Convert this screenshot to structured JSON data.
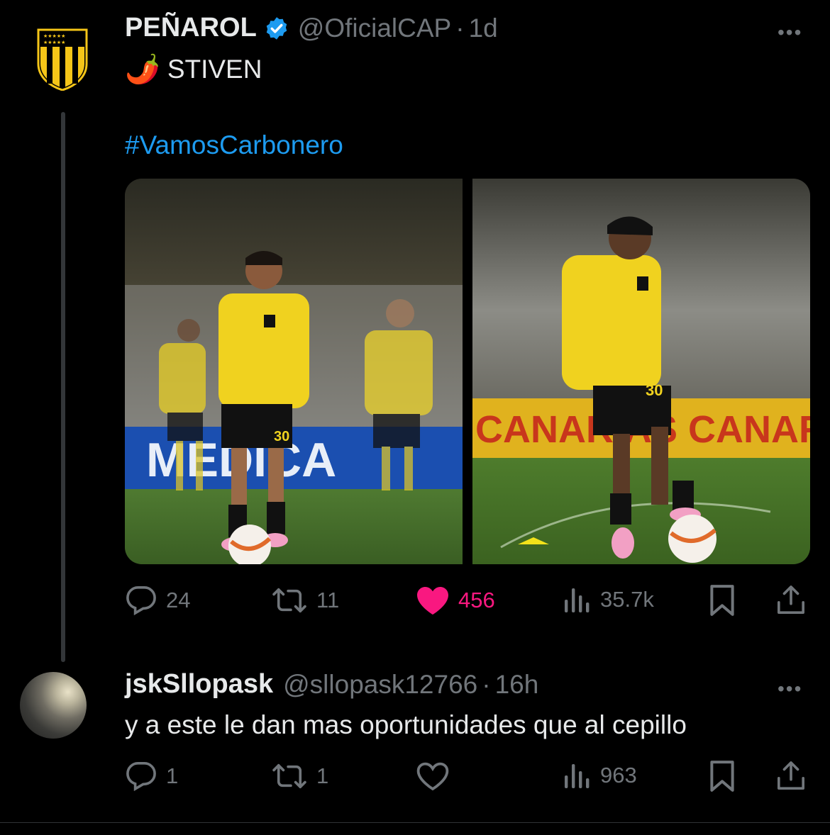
{
  "tweet": {
    "author_name": "PEÑAROL",
    "handle": "@OficialCAP",
    "separator": "·",
    "time": "1d",
    "more": "•••",
    "line1_emoji": "🌶️",
    "line1_text": "STIVEN",
    "hashtag": "#VamosCarbonero",
    "stats": {
      "replies": "24",
      "retweets": "11",
      "likes": "456",
      "views": "35.7k"
    },
    "media": {
      "left_banner": "MEDICA",
      "right_banner": "CANARIAS CANAR",
      "jersey_number": "30"
    }
  },
  "reply": {
    "author_name": "jskSllopask",
    "handle": "@sllopask12766",
    "separator": "·",
    "time": "16h",
    "more": "•••",
    "text": "y a este le dan mas oportunidades que al cepillo",
    "stats": {
      "replies": "1",
      "retweets": "1",
      "views": "963"
    }
  },
  "colors": {
    "background": "#000000",
    "text": "#e7e9ea",
    "muted": "#71767b",
    "link": "#1d9bf0",
    "like": "#f91880",
    "verified": "#1d9bf0",
    "club_yellow": "#f5c518"
  }
}
